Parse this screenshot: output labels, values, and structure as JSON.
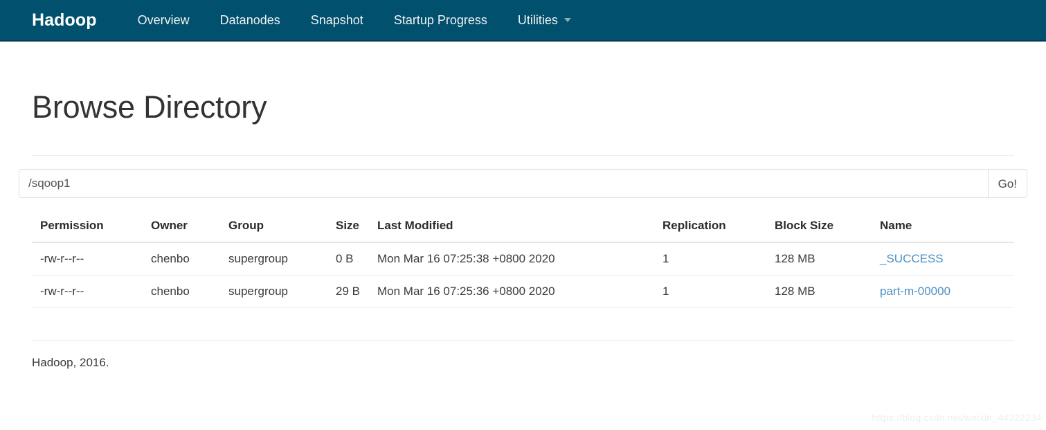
{
  "navbar": {
    "brand": "Hadoop",
    "background_color": "#00506e",
    "items": [
      {
        "label": "Overview",
        "has_caret": false
      },
      {
        "label": "Datanodes",
        "has_caret": false
      },
      {
        "label": "Snapshot",
        "has_caret": false
      },
      {
        "label": "Startup Progress",
        "has_caret": false
      },
      {
        "label": "Utilities",
        "has_caret": true
      }
    ]
  },
  "page": {
    "title": "Browse Directory"
  },
  "path_bar": {
    "value": "/sqoop1",
    "placeholder": "Enter path",
    "go_label": "Go!"
  },
  "table": {
    "columns": [
      "Permission",
      "Owner",
      "Group",
      "Size",
      "Last Modified",
      "Replication",
      "Block Size",
      "Name"
    ],
    "rows": [
      {
        "permission": "-rw-r--r--",
        "owner": "chenbo",
        "group": "supergroup",
        "size": "0 B",
        "last_modified": "Mon Mar 16 07:25:38 +0800 2020",
        "replication": "1",
        "block_size": "128 MB",
        "name": "_SUCCESS"
      },
      {
        "permission": "-rw-r--r--",
        "owner": "chenbo",
        "group": "supergroup",
        "size": "29 B",
        "last_modified": "Mon Mar 16 07:25:36 +0800 2020",
        "replication": "1",
        "block_size": "128 MB",
        "name": "part-m-00000"
      }
    ],
    "link_color": "#4a90c4"
  },
  "footer": {
    "text": "Hadoop, 2016."
  },
  "watermark": {
    "text": "https://blog.csdn.net/weixin_44322234"
  }
}
